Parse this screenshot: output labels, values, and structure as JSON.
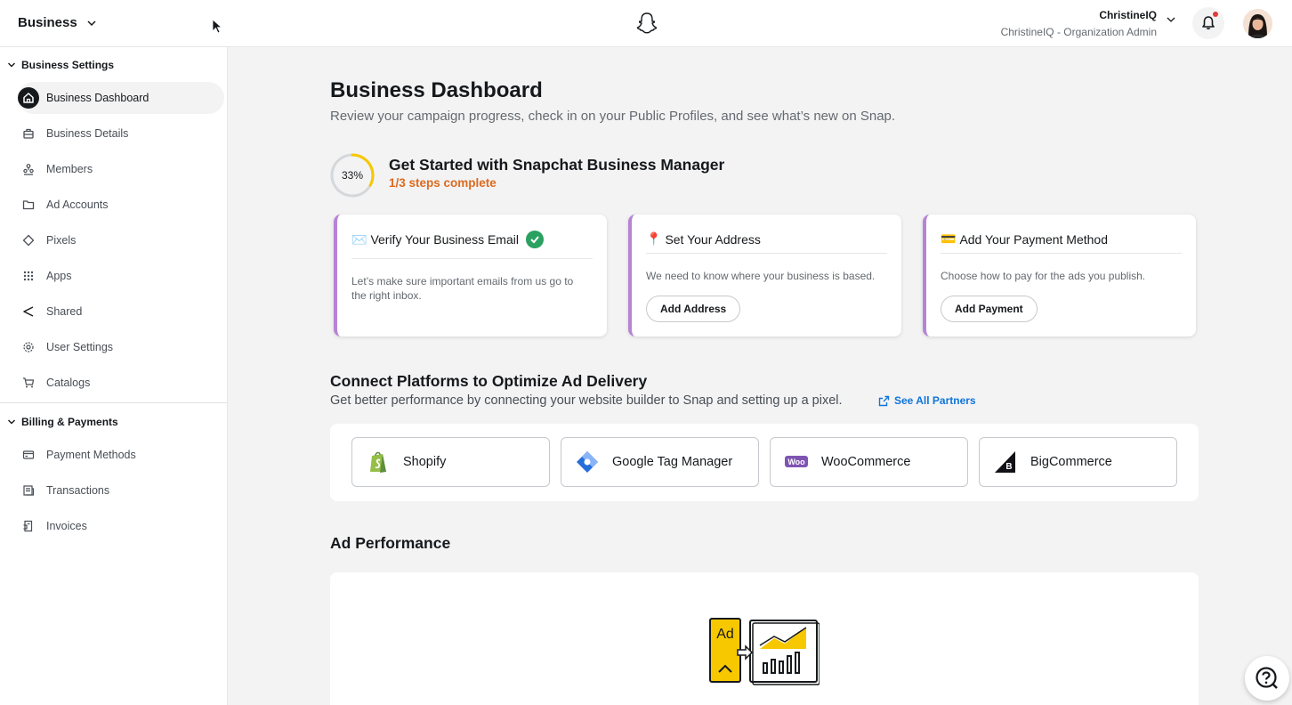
{
  "header": {
    "brand": "Business",
    "user_name": "ChristineIQ",
    "user_role": "ChristineIQ - Organization Admin"
  },
  "sidebar": {
    "sections": [
      {
        "label": "Business Settings",
        "items": [
          {
            "label": "Business Dashboard",
            "icon": "home-icon",
            "active": true
          },
          {
            "label": "Business Details",
            "icon": "briefcase-icon"
          },
          {
            "label": "Members",
            "icon": "members-icon"
          },
          {
            "label": "Ad Accounts",
            "icon": "folder-icon"
          },
          {
            "label": "Pixels",
            "icon": "diamond-icon"
          },
          {
            "label": "Apps",
            "icon": "grid-icon"
          },
          {
            "label": "Shared",
            "icon": "share-icon"
          },
          {
            "label": "User Settings",
            "icon": "gear-icon"
          },
          {
            "label": "Catalogs",
            "icon": "cart-icon"
          }
        ]
      },
      {
        "label": "Billing & Payments",
        "items": [
          {
            "label": "Payment Methods",
            "icon": "credit-card-icon"
          },
          {
            "label": "Transactions",
            "icon": "receipt-icon"
          },
          {
            "label": "Invoices",
            "icon": "invoice-icon"
          }
        ]
      }
    ]
  },
  "main": {
    "title": "Business Dashboard",
    "subtitle": "Review your campaign progress, check in on your Public Profiles, and see what’s new on Snap.",
    "get_started": {
      "progress_label": "33%",
      "progress_fraction": 0.33,
      "title": "Get Started with Snapchat Business Manager",
      "steps": "1/3 steps complete"
    },
    "cards": [
      {
        "emoji": "✉️",
        "title": "Verify Your Business Email",
        "text": "Let’s make sure important emails from us go to the right inbox.",
        "completed": true
      },
      {
        "emoji": "📍",
        "title": "Set Your Address",
        "text": "We need to know where your business is based.",
        "button": "Add Address"
      },
      {
        "emoji": "💳",
        "title": "Add Your Payment Method",
        "text": "Choose how to pay for the ads you publish.",
        "button": "Add Payment"
      }
    ],
    "connect": {
      "title": "Connect Platforms to Optimize Ad Delivery",
      "subtitle": "Get better performance by connecting your website builder to Snap and setting up a pixel.",
      "link": "See All Partners",
      "platforms": [
        {
          "label": "Shopify",
          "icon": "shopify-icon"
        },
        {
          "label": "Google Tag Manager",
          "icon": "google-tag-manager-icon"
        },
        {
          "label": "WooCommerce",
          "icon": "woocommerce-icon"
        },
        {
          "label": "BigCommerce",
          "icon": "bigcommerce-icon"
        }
      ]
    },
    "ad_performance": {
      "title": "Ad Performance",
      "illustration_text": "Ad"
    }
  },
  "colors": {
    "accent_purple": "#b784d4",
    "progress_yellow": "#f7c800",
    "steps_orange": "#dc6a1f",
    "link_blue": "#0f75d9",
    "check_green": "#2aa160"
  }
}
